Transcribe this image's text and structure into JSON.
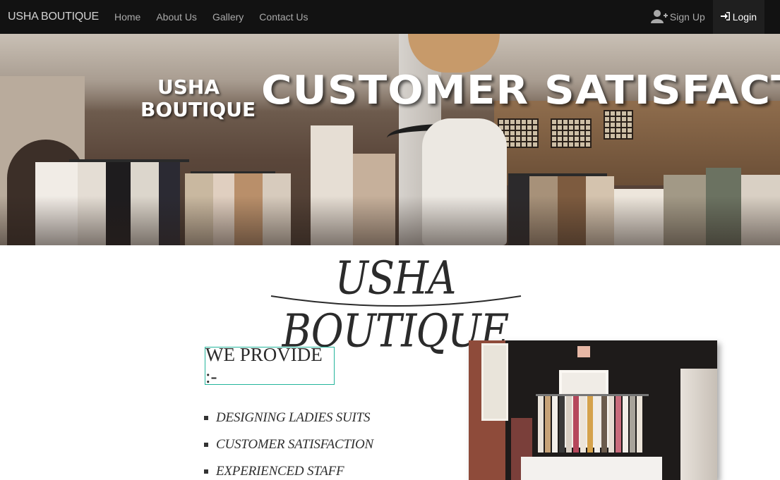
{
  "navbar": {
    "brand": "USHA BOUTIQUE",
    "links": [
      "Home",
      "About Us",
      "Gallery",
      "Contact Us"
    ],
    "signup_label": "Sign Up",
    "login_label": "Login"
  },
  "hero": {
    "small_line1": "USHA",
    "small_line2": "BOUTIQUE",
    "headline": "CUSTOMER SATISFACTION"
  },
  "section": {
    "title": "USHA BOUTIQUE",
    "provide_heading": "WE PROVIDE :-",
    "features": [
      "DESIGNING LADIES SUITS",
      "CUSTOMER SATISFACTION",
      "EXPERIENCED STAFF"
    ]
  },
  "colors": {
    "navbar_bg": "#121212",
    "accent_border": "#24b59c"
  },
  "icons": {
    "signup": "user-plus-icon",
    "login": "sign-in-icon"
  }
}
